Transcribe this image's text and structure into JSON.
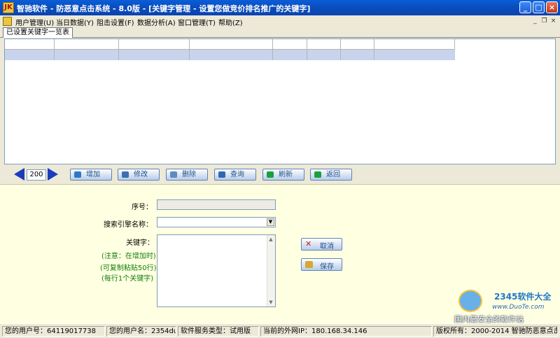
{
  "window": {
    "title": "智驰软件 - 防恶意点击系统 - 8.0版 - [关键字管理 - 设置您做竞价排名推广的关键字]",
    "app_icon": "JK",
    "controls": {
      "minimize": "_",
      "maximize": "□",
      "close": "×"
    }
  },
  "menu": {
    "items": [
      "用户管理(U)",
      "当日数据(Y)",
      "阻击设置(F)",
      "数据分析(A)",
      "窗口管理(T)",
      "帮助(Z)"
    ],
    "mdi_controls": {
      "minimize": "_",
      "restore": "❐",
      "close": "×"
    }
  },
  "tab": {
    "label": "已设置关键字一览表"
  },
  "toolbar": {
    "page_value": "200",
    "buttons": [
      {
        "label": "增加",
        "color": "#2f78c9"
      },
      {
        "label": "修改",
        "color": "#3b6fb0"
      },
      {
        "label": "删除",
        "color": "#5f8ac0"
      },
      {
        "label": "查询",
        "color": "#2f68b0"
      },
      {
        "label": "刷新",
        "color": "#1aa040"
      },
      {
        "label": "返回",
        "color": "#19a03c"
      }
    ]
  },
  "form": {
    "serial_label": "序号：",
    "engine_label": "搜索引擎名称：",
    "keyword_label": "关键字：",
    "note_lines": [
      "(注意：在增加时)",
      "(可复制粘贴50行)",
      "(每行1个关键字)"
    ],
    "cancel_label": "取消",
    "save_label": "保存"
  },
  "watermark": {
    "brand": "2345软件大全",
    "domain": "www.DuoTe.com",
    "slogan": "国内最安全的软件站"
  },
  "status": {
    "user_id": "您的用户号：64119017738",
    "user_name": "您的用户名：2354duote",
    "service_type": "软件服务类型：试用版",
    "ip": "当前的外网IP：180.168.34.146",
    "copyright": "版权所有：2000-2014  智驰防恶意点击"
  }
}
